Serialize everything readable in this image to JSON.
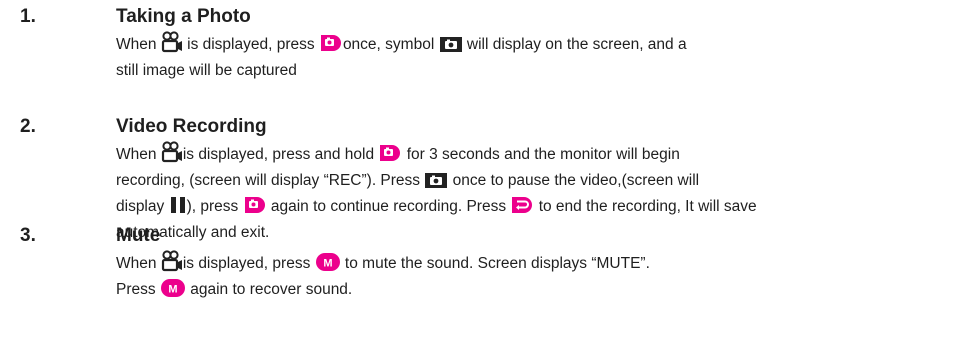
{
  "sections": [
    {
      "number": "1.",
      "title": "Taking a Photo",
      "text": [
        "When ",
        " is displayed, press ",
        "once, symbol ",
        " will display on the screen, and a",
        "still image will be captured"
      ]
    },
    {
      "number": "2.",
      "title": "Video Recording",
      "text": [
        "When ",
        "is displayed, press and hold ",
        " for 3 seconds and the monitor will begin",
        "recording, (screen will display “REC”). Press ",
        " once to pause the video,(screen will",
        "display ",
        "), press ",
        " again to continue recording. Press ",
        " to end the recording, It will save",
        "automatically and exit."
      ]
    },
    {
      "number": "3.",
      "title": "Mute",
      "text": [
        "When ",
        "is displayed, press ",
        " to mute the sound. Screen displays “MUTE”.",
        "Press ",
        " again to recover sound."
      ]
    }
  ],
  "icons": {
    "video_mode": "camcorder-icon",
    "photo_button": "camera-button-icon",
    "photo_symbol": "camera-symbol-icon",
    "pause_symbol": "pause-icon",
    "back_button": "return-button-icon",
    "mute_button": "mute-button-icon",
    "mute_label": "M"
  },
  "colors": {
    "button_fill": "#ec008c",
    "symbol_fill": "#222222",
    "text": "#1f1f1f"
  }
}
